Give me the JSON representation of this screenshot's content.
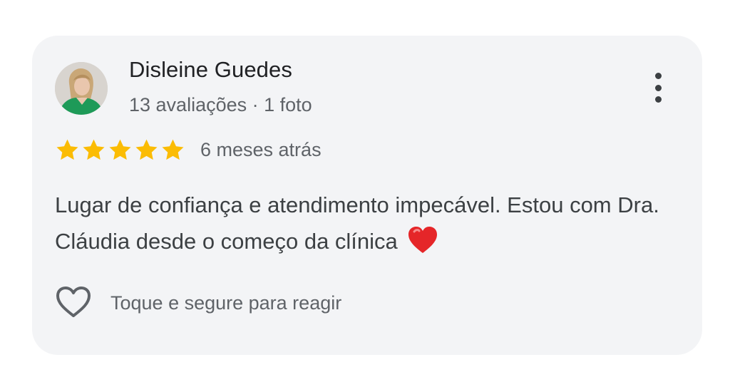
{
  "review": {
    "author_name": "Disleine Guedes",
    "author_meta": "13 avaliações · 1 foto",
    "rating": 5,
    "rating_max": 5,
    "time_ago": "6 meses atrás",
    "text": "Lugar de confiança e atendimento impecável. Estou com Dra. Cláudia desde o começo da clínica",
    "emoji": "❤️",
    "react_label": "Toque e segure para reagir"
  },
  "colors": {
    "card_bg": "#f3f4f6",
    "star": "#fbbc04",
    "heart_emoji": "#e52629",
    "primary_text": "#202124",
    "secondary_text": "#5f6368"
  },
  "icons": {
    "more": "more-vert-icon",
    "react": "heart-outline-icon",
    "star": "star-icon"
  }
}
